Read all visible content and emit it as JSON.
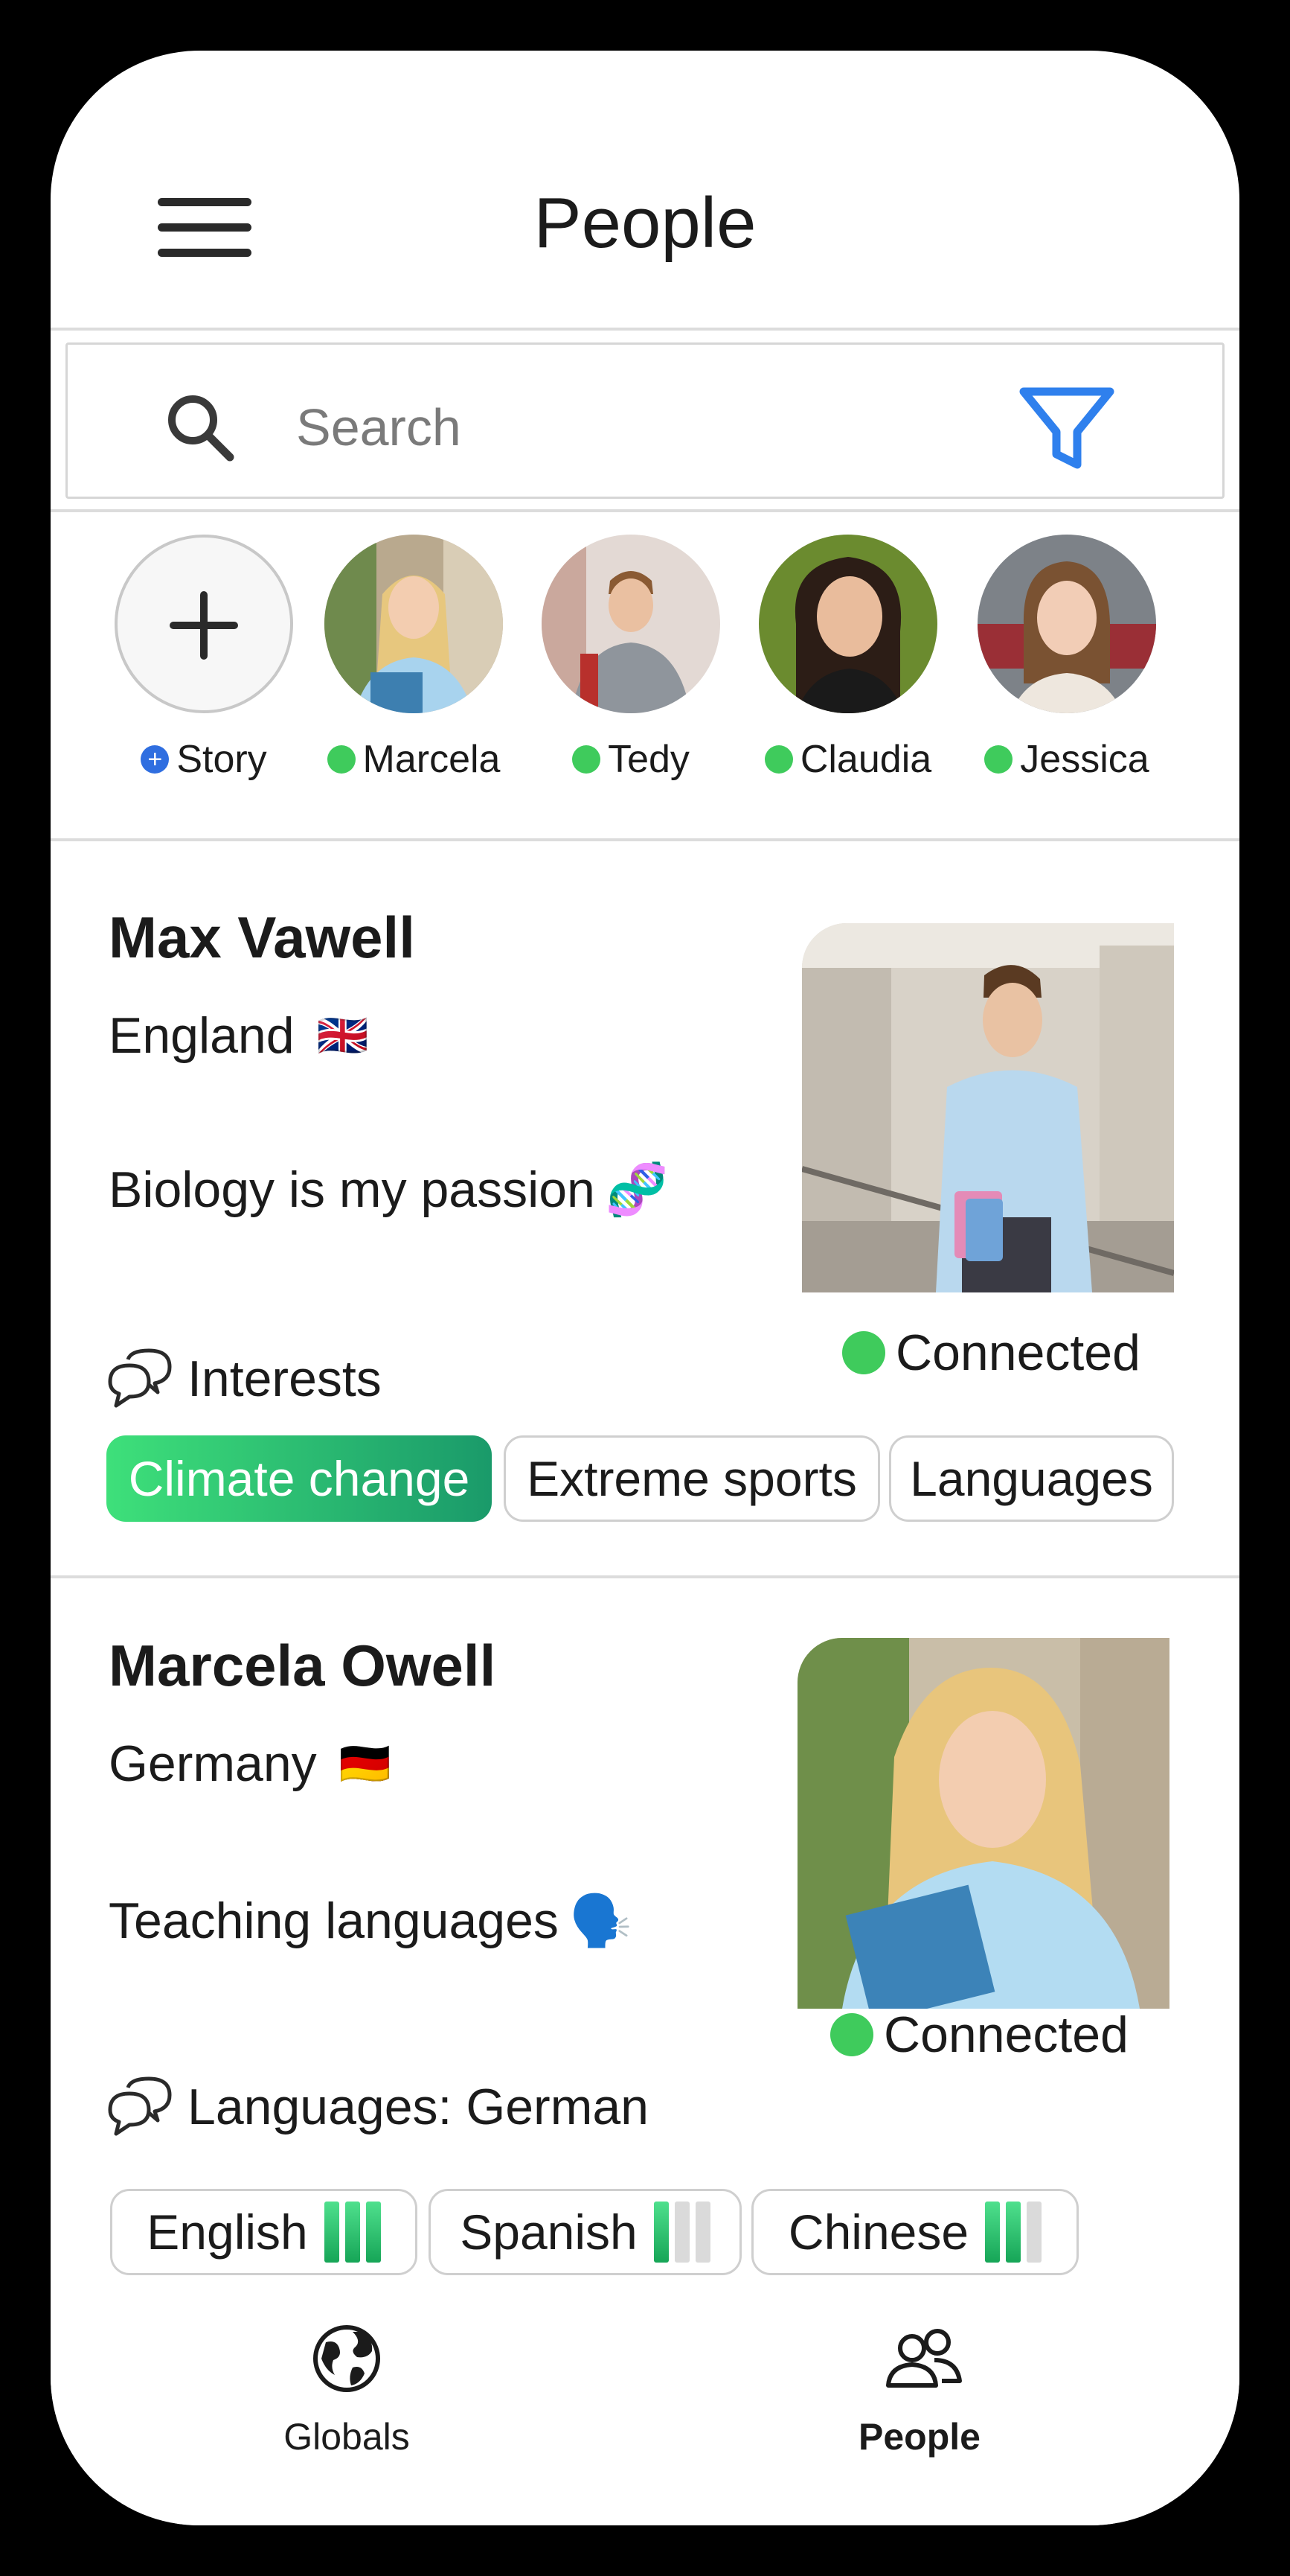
{
  "header": {
    "title": "People"
  },
  "search": {
    "placeholder": "Search"
  },
  "stories": [
    {
      "label": "Story",
      "type": "add"
    },
    {
      "label": "Marcela",
      "online": true
    },
    {
      "label": "Tedy",
      "online": true
    },
    {
      "label": "Claudia",
      "online": true
    },
    {
      "label": "Jessica",
      "online": true
    }
  ],
  "people": [
    {
      "name": "Max Vawell",
      "country": "England",
      "flag": "🇬🇧",
      "bio": "Biology is my passion",
      "bio_emoji": "🧬",
      "status": "Connected",
      "section_label": "Interests",
      "chips": [
        "Climate change",
        "Extreme sports",
        "Languages"
      ]
    },
    {
      "name": "Marcela Owell",
      "country": "Germany",
      "flag": "🇩🇪",
      "bio": "Teaching languages",
      "bio_emoji": "🗣️",
      "status": "Connected",
      "section_label": "Languages: German",
      "languages": [
        {
          "name": "English",
          "level": 3
        },
        {
          "name": "Spanish",
          "level": 1
        },
        {
          "name": "Chinese",
          "level": 2
        }
      ]
    }
  ],
  "bottom_nav": [
    {
      "label": "Globals",
      "icon": "globe-icon",
      "active": false
    },
    {
      "label": "People",
      "icon": "people-icon",
      "active": true
    }
  ],
  "colors": {
    "accent": "#2f80ed",
    "online": "#3fcb5c",
    "chip_gradient_start": "#3ee07a",
    "chip_gradient_end": "#1a9a6a"
  }
}
